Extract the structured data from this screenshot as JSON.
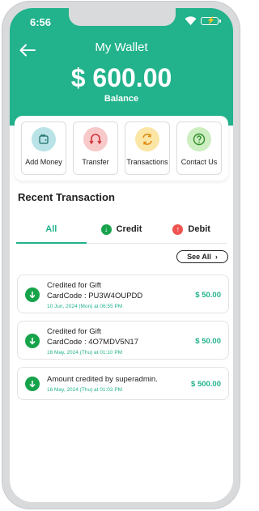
{
  "status_bar": {
    "time": "6:56"
  },
  "header": {
    "title": "My Wallet",
    "amount": "$ 600.00",
    "amount_label": "Balance"
  },
  "colors": {
    "accent": "#22b28c",
    "credit_green": "#16a34a",
    "debit_red": "#ef5350"
  },
  "actions": [
    {
      "label": "Add Money",
      "icon": "wallet-icon"
    },
    {
      "label": "Transfer",
      "icon": "transfer-icon"
    },
    {
      "label": "Transactions",
      "icon": "exchange-icon"
    },
    {
      "label": "Contact Us",
      "icon": "question-icon"
    }
  ],
  "recent": {
    "title": "Recent Transaction",
    "tabs": [
      {
        "label": "All",
        "active": true
      },
      {
        "label": "Credit"
      },
      {
        "label": "Debit"
      }
    ],
    "see_all": "See All",
    "items": [
      {
        "line1": "Credited for Gift",
        "line2": "CardCode : PU3W4OUPDD",
        "date": "10 Jun, 2024 (Mon) at 06:55 PM",
        "amount": "$ 50.00"
      },
      {
        "line1": "Credited for Gift",
        "line2": "CardCode : 4O7MDV5N17",
        "date": "16 May, 2024 (Thu) at 01:10 PM",
        "amount": "$ 50.00"
      },
      {
        "line1": "Amount credited by superadmin.",
        "line2": "",
        "date": "16 May, 2024 (Thu) at 01:03 PM",
        "amount": "$ 500.00"
      }
    ]
  }
}
